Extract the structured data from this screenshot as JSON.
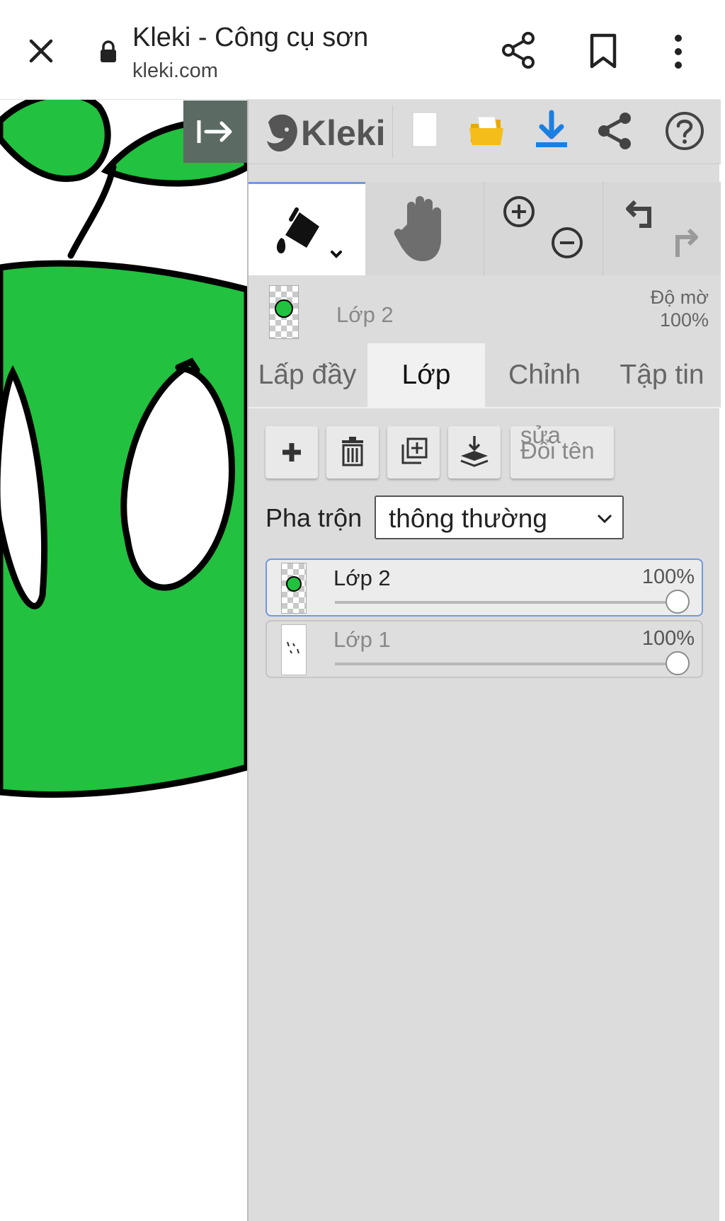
{
  "browser": {
    "page_title": "Kleki - Công cụ sơn",
    "url": "kleki.com",
    "icons": [
      "close-icon",
      "lock-icon",
      "share-icon",
      "bookmark-icon",
      "more-vert-icon"
    ]
  },
  "app": {
    "logo_text": "Kleki",
    "toolbar_icons": [
      "new-image-icon",
      "open-folder-icon",
      "download-icon",
      "share-icon",
      "help-icon"
    ],
    "accent_color": "#1a7fe0"
  },
  "tools": {
    "active": "paint-bucket",
    "items": [
      "paint-bucket-icon",
      "hand-icon",
      "zoom-in-icon",
      "zoom-out-icon",
      "undo-icon",
      "redo-icon"
    ]
  },
  "current_layer": {
    "name": "Lớp 2",
    "opacity_label": "Độ mờ",
    "opacity_value": "100%"
  },
  "tabs": [
    {
      "label": "Lấp đầy",
      "active": false
    },
    {
      "label": "Lớp",
      "active": true
    },
    {
      "label": "Chỉnh",
      "active": false
    },
    {
      "label": "Tập tin",
      "active": false
    }
  ],
  "layer_buttons": {
    "icons": [
      "add-layer-icon",
      "delete-layer-icon",
      "duplicate-layer-icon",
      "merge-down-icon"
    ],
    "rename_line1": "sửa",
    "rename_line2": "Đổi tên"
  },
  "blend": {
    "label": "Pha trộn",
    "value": "thông thường"
  },
  "layers": [
    {
      "name": "Lớp 2",
      "opacity": "100%",
      "selected": true,
      "opacity_fraction": 1.0
    },
    {
      "name": "Lớp 1",
      "opacity": "100%",
      "selected": false,
      "opacity_fraction": 1.0
    }
  ],
  "canvas": {
    "fill_color": "#22c13f",
    "stroke_color": "#000000"
  }
}
